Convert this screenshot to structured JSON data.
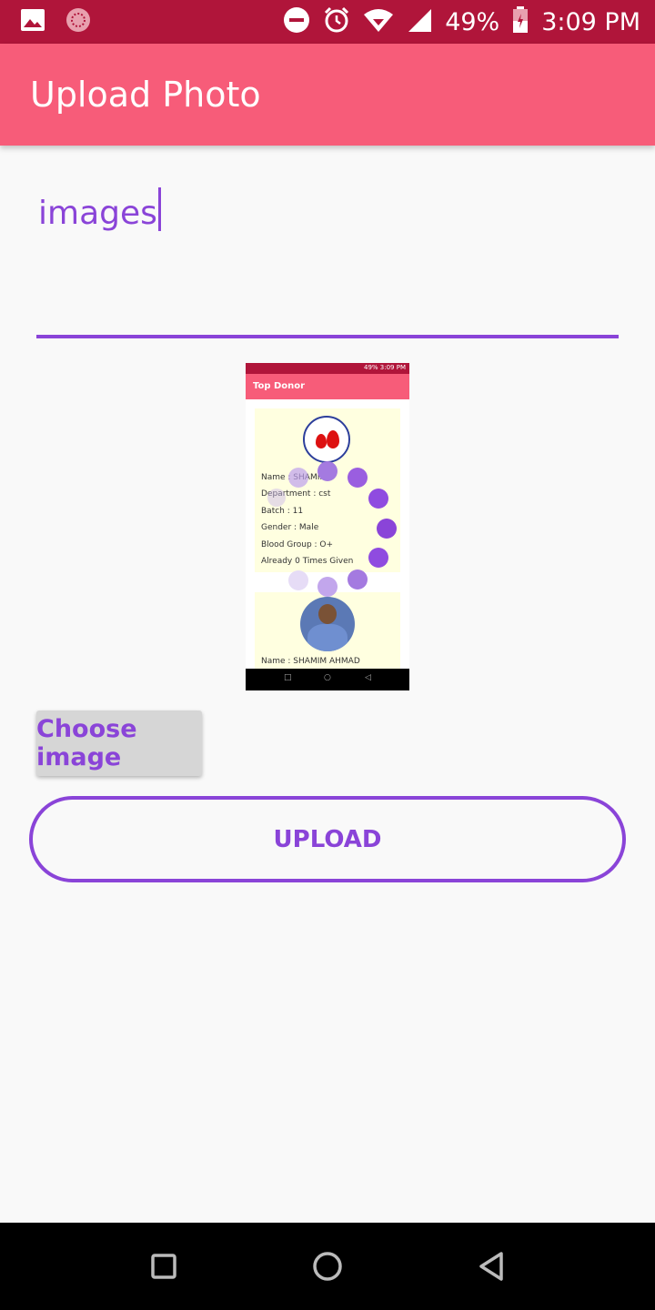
{
  "status_bar": {
    "battery": "49%",
    "time": "3:09 PM",
    "icons": [
      "image-icon",
      "app-notification-icon",
      "do-not-disturb-icon",
      "alarm-icon",
      "wifi-icon",
      "signal-icon",
      "battery-icon"
    ]
  },
  "app_bar": {
    "title": "Upload Photo"
  },
  "input": {
    "value": "images"
  },
  "preview": {
    "status_text": "49% 3:09 PM",
    "title": "Top Donor",
    "lines": [
      "Name : SHAMIM",
      "Department : cst",
      "Batch : 11",
      "Gender : Male",
      "Blood Group : O+",
      "Already 0 Times Given"
    ],
    "second_name": "Name : SHAMIM AHMAD",
    "loading_color": "#8a44d8"
  },
  "buttons": {
    "choose_label": "Choose image",
    "upload_label": "UPLOAD"
  },
  "nav": {
    "icons": [
      "recents-icon",
      "home-icon",
      "back-icon"
    ]
  },
  "colors": {
    "status_bar": "#b0153a",
    "app_bar": "#f75c79",
    "accent": "#8a44d8"
  }
}
